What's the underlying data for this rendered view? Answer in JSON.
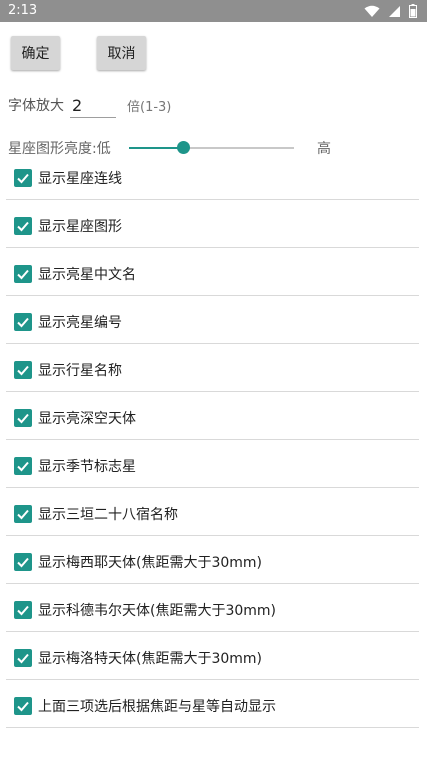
{
  "status": {
    "time": "2:13",
    "icons": [
      "wifi-icon",
      "signal-icon",
      "battery-icon"
    ]
  },
  "buttons": {
    "ok": "确定",
    "cancel": "取消"
  },
  "font_scale": {
    "label": "字体放大",
    "value": "2",
    "suffix": "倍(1-3)"
  },
  "brightness": {
    "label": "星座图形亮度:低",
    "high_label": "高",
    "value_fraction": 0.33
  },
  "options": [
    {
      "label": "显示星座连线",
      "checked": true
    },
    {
      "label": "显示星座图形",
      "checked": true
    },
    {
      "label": "显示亮星中文名",
      "checked": true
    },
    {
      "label": "显示亮星编号",
      "checked": true
    },
    {
      "label": "显示行星名称",
      "checked": true
    },
    {
      "label": "显示亮深空天体",
      "checked": true
    },
    {
      "label": "显示季节标志星",
      "checked": true
    },
    {
      "label": "显示三垣二十八宿名称",
      "checked": true
    },
    {
      "label": "显示梅西耶天体(焦距需大于30mm)",
      "checked": true
    },
    {
      "label": "显示科德韦尔天体(焦距需大于30mm)",
      "checked": true
    },
    {
      "label": "显示梅洛特天体(焦距需大于30mm)",
      "checked": true
    },
    {
      "label": "上面三项选后根据焦距与星等自动显示",
      "checked": true
    }
  ],
  "colors": {
    "accent": "#1e958a",
    "statusbar": "#8f8f8f",
    "button": "#d6d6d6"
  }
}
